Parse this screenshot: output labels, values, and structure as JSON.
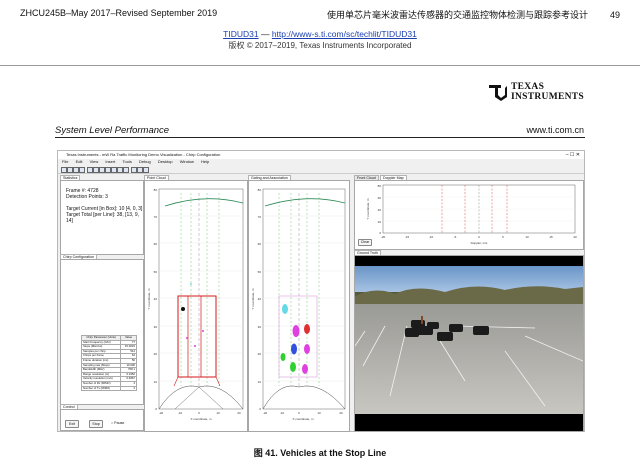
{
  "header": {
    "doc_id": "ZHCU245B",
    "date_line": "–May 2017–Revised September 2019",
    "title_cn": "使用单芯片毫米波雷达传感器的交通监控物体检测与跟踪参考设计",
    "page": "49",
    "link_text": "TIDUD31",
    "link_sep": "—",
    "link_url": "http://www-s.ti.com/sc/techlit/TIDUD31",
    "copyright": "版权 © 2017–2019, Texas Instruments Incorporated"
  },
  "logo": {
    "line1": "TEXAS",
    "line2": "INSTRUMENTS",
    "mark": "ti-logo-icon"
  },
  "section": {
    "title": "System Level Performance",
    "url": "www.ti.com.cn"
  },
  "caption": "图 41. Vehicles at the Stop Line",
  "app": {
    "title": "Texas Instruments - mW Ra Traffic Monitoring Demo Visualization - Chirp Configuration",
    "menu": [
      "File",
      "Edit",
      "View",
      "Insert",
      "Tools",
      "Debug",
      "Desktop",
      "Window",
      "Help"
    ],
    "tabs": {
      "statistics": "Statistics",
      "point_cloud": "Point Cloud",
      "gating": "Gating and Association",
      "front_cloud": "Front Cloud",
      "doppler_map": "Doppler Map",
      "chirp_config": "Chirp Configuration",
      "ground_truth": "Ground Truth",
      "control": "Control"
    },
    "stats": {
      "frame": "Frame #: 4728",
      "detection": "Detection Points: 3",
      "target_current": "Target Current [in Box]: 10 [4, 0, 3]",
      "target_total": "Target Total [per Line]: 38, [13, 9, 14]"
    },
    "params": {
      "headers": [
        "Chirp Parameter (Units)",
        "Value"
      ],
      "rows": [
        [
          "Start Frequency (Ghz)",
          "77"
        ],
        [
          "Slope (MHz/us)",
          "15.0015"
        ],
        [
          "Samples per chirp",
          "512"
        ],
        [
          "Chirps per frame",
          "64"
        ],
        [
          "Frame duration (ms)",
          "50"
        ],
        [
          "Sampling rate (Msps)",
          "10.000"
        ],
        [
          "Bandwidth (MHz)",
          "768.1"
        ],
        [
          "Range resolution (m)",
          "0.1952"
        ],
        [
          "Velocity resolution (m/s)",
          "0.4867"
        ],
        [
          "Number of Rx (MIMO)",
          "4"
        ],
        [
          "Number of Tx (MIMO)",
          "2"
        ]
      ]
    },
    "control": {
      "exit": "Exit",
      "stop": "Stop",
      "pause": "Pause"
    },
    "clear_btn": "Clear",
    "point_cloud": {
      "xlabel": "X coordinate, m",
      "ylabel": "Y coordinate, m",
      "xticks": [
        "-20",
        "-10",
        "0",
        "10",
        "20"
      ],
      "yticks": [
        "80",
        "70",
        "60",
        "50",
        "40",
        "30",
        "20",
        "10",
        "0"
      ]
    },
    "gating": {
      "xlabel": "X coordinate, m",
      "ylabel": "Y coordinate, m",
      "xticks": [
        "-20",
        "-10",
        "0",
        "10",
        "20"
      ],
      "yticks": [
        "80",
        "70",
        "60",
        "50",
        "40",
        "30",
        "20",
        "10",
        "0"
      ]
    },
    "doppler": {
      "xlabel": "Doppler, m/s",
      "ylabel": "Y coordinate, m",
      "xticks": [
        "-20",
        "-15",
        "-10",
        "-5",
        "0",
        "5",
        "10",
        "15",
        "20"
      ],
      "yticks": [
        "80",
        "60",
        "40",
        "20",
        "0"
      ]
    }
  }
}
